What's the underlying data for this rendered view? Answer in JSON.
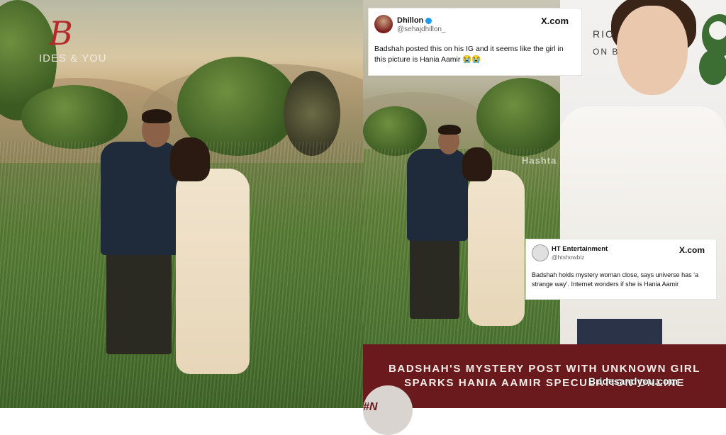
{
  "logo": {
    "letter": "B",
    "text": "IDES & YOU"
  },
  "tweet1": {
    "name": "Dhillon",
    "handle": "@sehajdhillon_",
    "source": "X.com",
    "text": "Badshah posted this on his IG and it seems like the girl in this picture is Hania Aamir 😭😭"
  },
  "tweet2": {
    "name": "HT Entertainment",
    "handle": "@htshowbiz",
    "source": "X.com",
    "text": "Badshah holds mystery woman close, says universe has ‘a strange way’. Internet wonders if she is Hania Aamir"
  },
  "panel3": {
    "brand_line1": "RIO",
    "brand_line2": "ON B"
  },
  "photo_watermark": "Hashta",
  "headline": {
    "line1": "BADSHAH'S MYSTERY POST WITH UNKNOWN GIRL",
    "line2": "SPARKS HANIA AAMIR SPECULATION ONLINE"
  },
  "site_watermark": "Bridesandyou.com",
  "corner_badge": "#N",
  "colors": {
    "banner_bg": "#6a1a1c",
    "logo_accent": "#b42a2a",
    "verified": "#1d9bf0"
  }
}
